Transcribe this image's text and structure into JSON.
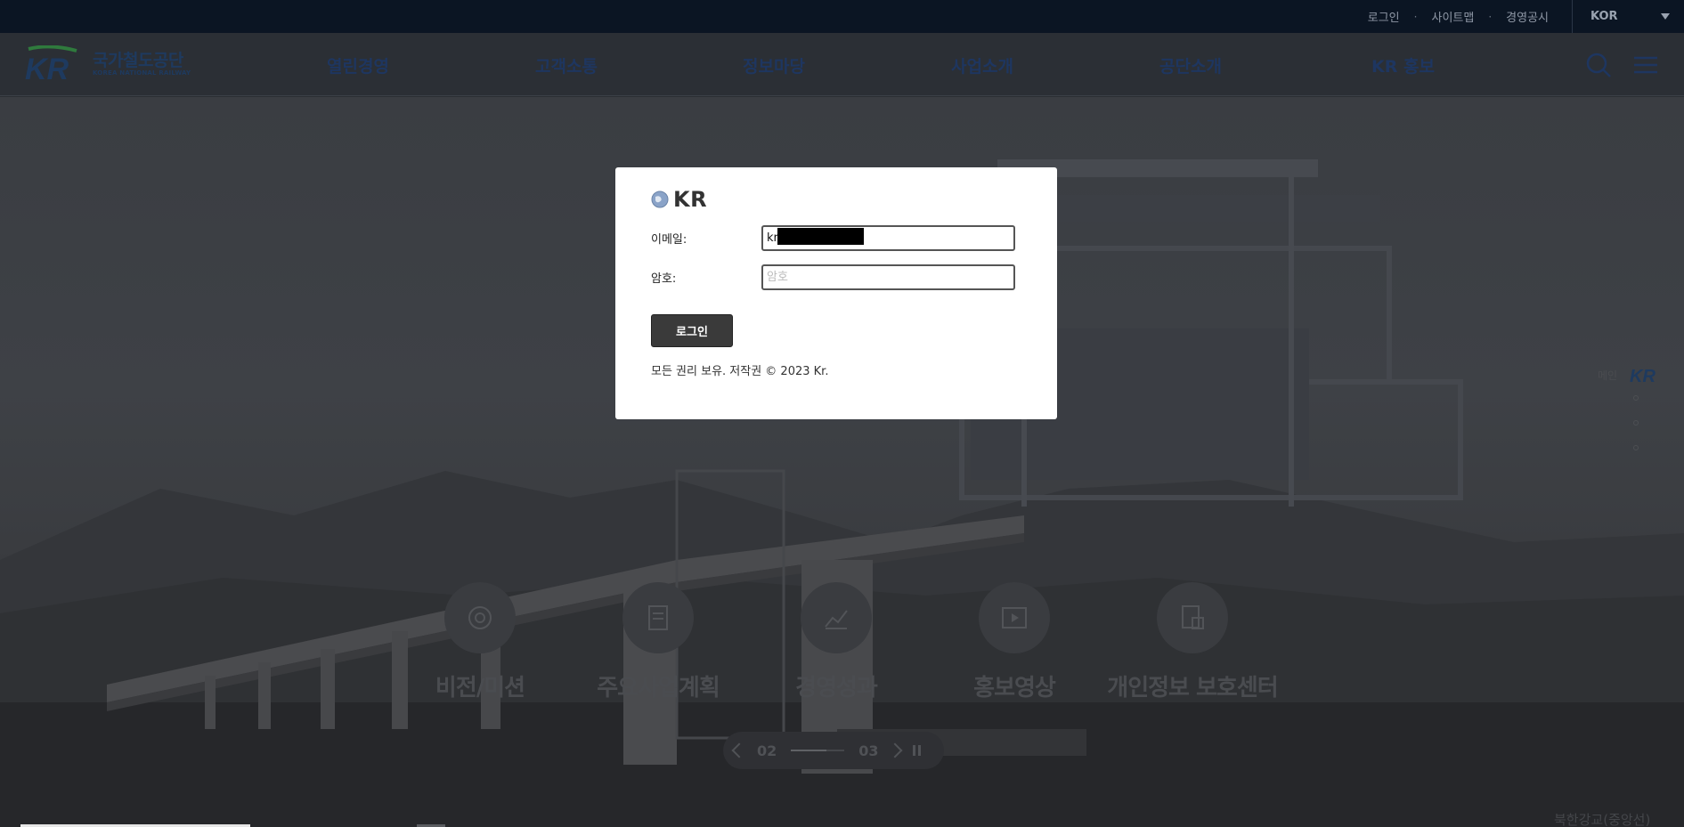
{
  "topbar": {
    "links": [
      "로그인",
      "사이트맵",
      "경영공시"
    ],
    "lang": "KOR"
  },
  "header": {
    "logo_ko": "국가철도공단",
    "logo_en": "KOREA NATIONAL RAILWAY",
    "nav": [
      "열린경영",
      "고객소통",
      "정보마당",
      "사업소개",
      "공단소개",
      "KR 홍보"
    ]
  },
  "hero": {
    "quick_links": [
      "비전/미션",
      "주요사업계획",
      "경영성과",
      "홍보영상",
      "개인정보 보호센터"
    ],
    "slider": {
      "current": "02",
      "next": "03",
      "progress": 0.66
    },
    "side_pager_label": "메인",
    "bottom_right_text": "북한강교(중앙선)"
  },
  "modal": {
    "brand": "KR",
    "email_label": "이메일:",
    "email_value": "kr",
    "password_label": "암호:",
    "password_placeholder": "암호",
    "login_button": "로그인",
    "copyright": "모든 권리 보유. 저작권 © 2023 Kr."
  },
  "colors": {
    "topbar_bg": "#0b1523",
    "nav_text": "#1e3660",
    "modal_button": "#3a3a3a"
  }
}
